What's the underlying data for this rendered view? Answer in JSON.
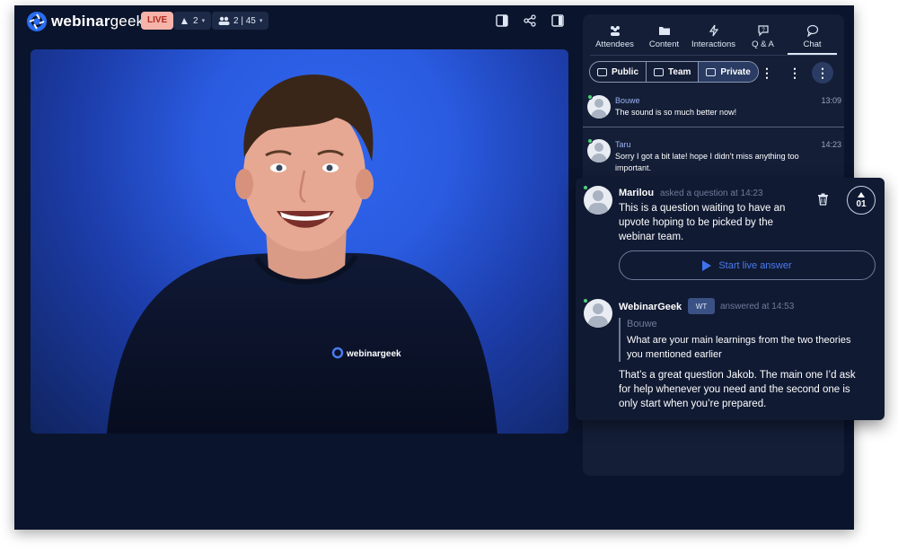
{
  "brand": {
    "name_bold": "webinar",
    "name_light": "geek"
  },
  "top_bar": {
    "live_label": "LIVE",
    "hosts_count": "2",
    "attendees_count": "2 | 45"
  },
  "video": {
    "shirt_logo_text": "webinargeek"
  },
  "panel": {
    "tabs": [
      {
        "label": "Attendees",
        "icon": "people-icon"
      },
      {
        "label": "Content",
        "icon": "folder-icon"
      },
      {
        "label": "Interactions",
        "icon": "lightning-icon"
      },
      {
        "label": "Q & A",
        "icon": "speech-question-icon"
      },
      {
        "label": "Chat",
        "icon": "chat-bubble-icon",
        "active": true
      }
    ],
    "chat_modes": [
      {
        "label": "Public"
      },
      {
        "label": "Team"
      },
      {
        "label": "Private",
        "selected": true
      }
    ],
    "messages": [
      {
        "name": "Bouwe",
        "time": "13:09",
        "text": "The sound is so much better now!"
      },
      {
        "name": "Taru",
        "time": "14:23",
        "text": "Sorry I got a bit late! hope I didn’t miss anything too important."
      }
    ]
  },
  "question_card": {
    "asker": "Marilou",
    "asked_meta": "asked a question at 14:23",
    "question": "This is a question waiting to have an upvote hoping to be picked by the webinar team.",
    "upvotes": "01",
    "live_answer_label": "Start live answer",
    "answerer": "WebinarGeek",
    "answerer_badge": "WT",
    "answered_meta": "answered at 14:53",
    "quoted_author": "Bouwe",
    "quoted_text": "What are your main learnings from the two theories you mentioned earlier",
    "answer": "That’s a great question Jakob. The main one I’d ask for help whenever you need and the second one is only start when you’re prepared."
  },
  "colors": {
    "accent": "#2a6df0",
    "live": "#f5b3a9",
    "online": "#4cd37a",
    "background": "#0a142c"
  }
}
